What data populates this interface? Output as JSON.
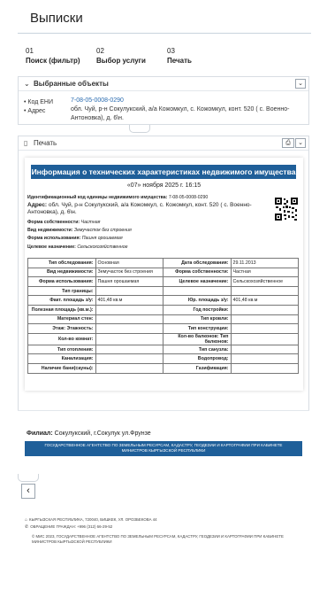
{
  "page": {
    "title": "Выписки"
  },
  "steps": [
    {
      "num": "01",
      "label": "Поиск (фильтр)"
    },
    {
      "num": "02",
      "label": "Выбор услуги"
    },
    {
      "num": "03",
      "label": "Печать"
    }
  ],
  "selected": {
    "title": "Выбранные объекты",
    "toggle_icon": "chevron-down-icon",
    "code_label": "• Код ЕНИ",
    "code_value": "7-08-05-0008-0290",
    "address_label": "• Адрес",
    "address_value": "обл. Чуй, р-н Сокулукский, а/а Кожомкул, с. Кожомкул, конт. 520 ( с. Военно-Антоновка), д. 6\\н."
  },
  "print": {
    "title": "Печать",
    "printer_icon": "printer-icon"
  },
  "doc": {
    "heading": "Информация о технических характеристиках недвижимого имущества",
    "date": "«07» ноября 2025 г. 16:15",
    "id_label": "Идентификационный код единицы недвижимого имущества:",
    "id_value": "7-08-05-0008-0290",
    "addr_label": "Адрес:",
    "addr_value": "обл. Чуй, р-н Сокулукский, а/а Кожомкул, с. Кожомкул, конт. 520 ( с. Военно-Антоновка), д. 6\\н.",
    "owner_label": "Форма собственности:",
    "owner_value": "Частная",
    "kind_label": "Вид недвижимости:",
    "kind_value": "Земучасток без строения",
    "use_label": "Форма использования:",
    "use_value": "Пашня орошаемая",
    "purpose_label": "Целевое назначение:",
    "purpose_value": "Сельскохозяйственное",
    "rows": [
      [
        "Тип обследования:",
        "Основная",
        "Дата обследования:",
        "29.11.2013"
      ],
      [
        "Вид недвижимости:",
        "Земучасток без строения",
        "Форма собственности:",
        "Частная"
      ],
      [
        "Форма использования:",
        "Пашня орошаемая",
        "Целевое назначение:",
        "Сельскохозяйственное"
      ],
      [
        "Тип границы:",
        "",
        "",
        ""
      ],
      [
        "Факт. площадь з/у:",
        "401,48 кв.м",
        "Юр. площадь з/у:",
        "401,48 кв.м"
      ],
      [
        "Полезная площадь (кв.м.):",
        "",
        "Год постройки:",
        ""
      ],
      [
        "Материал стен:",
        "",
        "Тип кровли:",
        ""
      ],
      [
        "Этаж: Этажность:",
        "",
        "Тип конструкции:",
        ""
      ],
      [
        "Кол-во комнат:",
        "",
        "Кол-во балконов: Тип балконов:",
        ""
      ],
      [
        "Тип отопления:",
        "",
        "Тип санузла:",
        ""
      ],
      [
        "Канализация:",
        "",
        "Водопровод:",
        ""
      ],
      [
        "Наличие бани(сауны):",
        "",
        "Газификация:",
        ""
      ]
    ]
  },
  "filial": {
    "label": "Филиал:",
    "value": "Сокулукский, г.Сокулук ул.Фрунзе"
  },
  "banner": {
    "line1": "ГОСУДАРСТВЕННОЕ АГЕНТСТВО ПО ЗЕМЕЛЬНЫМ РЕСУРСАМ, КАДАСТРУ, ГЕОДЕЗИИ И КАРТОГРАФИИ ПРИ КАБИНЕТЕ",
    "line2": "МИНИСТРОВ КЫРГЫЗСКОЙ РЕСПУБЛИКИ"
  },
  "footer": {
    "address": "КЫРГЫЗСКАЯ РЕСПУБЛИКА, 720040, БИШКЕК, УЛ. ОРОЗБЕКОВА 44",
    "phone": "ОБРАЩЕНИЕ ГРАЖДАН: +996 (312) 66-29-52",
    "copyright": "© МИС 2023, ГОСУДАРСТВЕННОЕ АГЕНТСТВО ПО ЗЕМЕЛЬНЫМ РЕСУРСАМ, КАДАСТРУ, ГЕОДЕЗИИ И КАРТОГРАФИИ ПРИ КАБИНЕТЕ",
    "copyright2": "МИНИСТРОВ КЫРГЫЗСКОЙ РЕСПУБЛИКИ"
  },
  "colors": {
    "accent": "#1f5f99",
    "link": "#2b6cb0"
  }
}
